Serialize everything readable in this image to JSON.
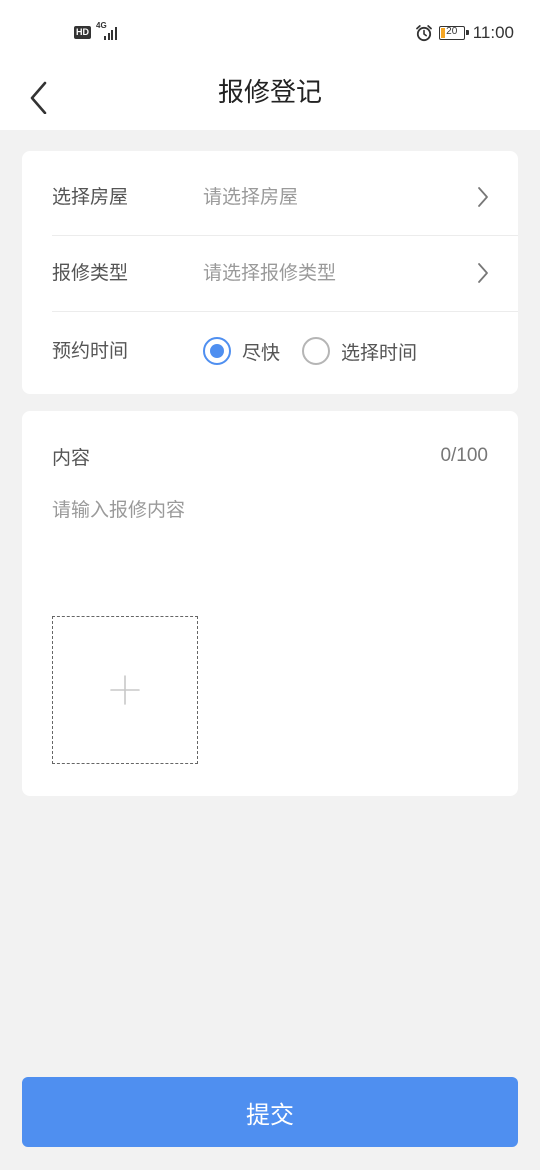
{
  "status_bar": {
    "hd_badge": "HD",
    "network_type": "4G",
    "battery_level": "20",
    "time": "11:00"
  },
  "nav": {
    "title": "报修登记",
    "back_icon": "chevron-left-icon"
  },
  "form": {
    "house": {
      "label": "选择房屋",
      "placeholder": "请选择房屋"
    },
    "repair_type": {
      "label": "报修类型",
      "placeholder": "请选择报修类型"
    },
    "appointment": {
      "label": "预约时间",
      "options": [
        {
          "label": "尽快",
          "selected": true
        },
        {
          "label": "选择时间",
          "selected": false
        }
      ]
    }
  },
  "content": {
    "label": "内容",
    "counter": "0/100",
    "placeholder": "请输入报修内容",
    "value": "",
    "upload_icon": "plus-icon"
  },
  "submit_label": "提交",
  "colors": {
    "accent": "#4f8ff0",
    "background": "#f2f2f2",
    "battery_fill": "#f5a623"
  }
}
